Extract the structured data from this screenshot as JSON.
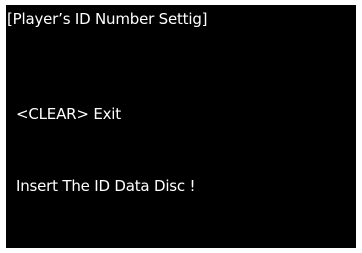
{
  "screen": {
    "title": "[Player’s ID Number Settig]",
    "clear_key": "<CLEAR>",
    "clear_action": "Exit",
    "message": "Insert The ID Data Disc !"
  }
}
